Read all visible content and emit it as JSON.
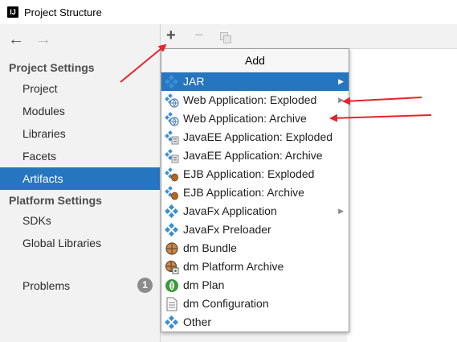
{
  "window": {
    "title": "Project Structure"
  },
  "left_pane": {
    "sections": [
      {
        "header": "Project Settings",
        "items": [
          "Project",
          "Modules",
          "Libraries",
          "Facets",
          "Artifacts"
        ]
      },
      {
        "header": "Platform Settings",
        "items": [
          "SDKs",
          "Global Libraries"
        ]
      }
    ],
    "selected": "Artifacts",
    "problems": {
      "label": "Problems",
      "count": "1"
    }
  },
  "toolbar": {
    "add": "+",
    "remove": "−"
  },
  "popup": {
    "title": "Add",
    "items": [
      {
        "label": "JAR",
        "icon": "artifact-icon",
        "submenu": true,
        "highlighted": true
      },
      {
        "label": "Web Application: Exploded",
        "icon": "web-artifact-icon",
        "submenu": true
      },
      {
        "label": "Web Application: Archive",
        "icon": "web-artifact-icon",
        "submenu": false
      },
      {
        "label": "JavaEE Application: Exploded",
        "icon": "javaee-artifact-icon",
        "submenu": false
      },
      {
        "label": "JavaEE Application: Archive",
        "icon": "javaee-artifact-icon",
        "submenu": false
      },
      {
        "label": "EJB Application: Exploded",
        "icon": "ejb-artifact-icon",
        "submenu": false
      },
      {
        "label": "EJB Application: Archive",
        "icon": "ejb-artifact-icon",
        "submenu": false
      },
      {
        "label": "JavaFx Application",
        "icon": "artifact-icon",
        "submenu": true
      },
      {
        "label": "JavaFx Preloader",
        "icon": "artifact-icon",
        "submenu": false
      },
      {
        "label": "dm Bundle",
        "icon": "dm-bundle-icon",
        "submenu": false
      },
      {
        "label": "dm Platform Archive",
        "icon": "dm-archive-icon",
        "submenu": false
      },
      {
        "label": "dm Plan",
        "icon": "dm-plan-icon",
        "submenu": false
      },
      {
        "label": "dm Configuration",
        "icon": "document-icon",
        "submenu": false
      },
      {
        "label": "Other",
        "icon": "artifact-icon",
        "submenu": false
      }
    ]
  },
  "colors": {
    "selection": "#2675bf",
    "annotation_arrow": "#e8232a",
    "artifact_icon": "#3b8fd6"
  }
}
